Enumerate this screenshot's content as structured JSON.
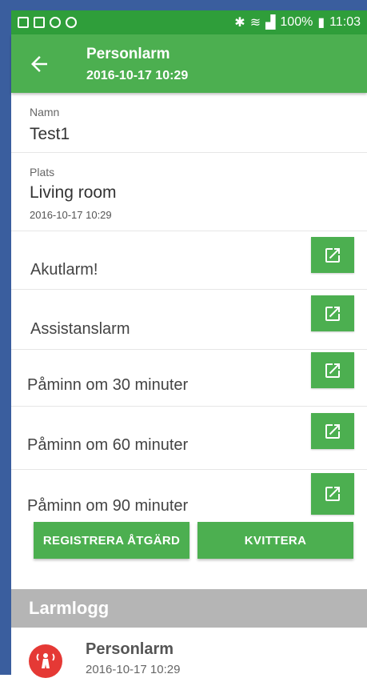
{
  "status_bar": {
    "battery": "100%",
    "time": "11:03"
  },
  "app_bar": {
    "title": "Personlarm",
    "subtitle": "2016-10-17 10:29"
  },
  "details": {
    "name_label": "Namn",
    "name_value": "Test1",
    "place_label": "Plats",
    "place_value": "Living room",
    "place_time": "2016-10-17 10:29"
  },
  "actions": [
    {
      "label": "Akutlarm!"
    },
    {
      "label": "Assistanslarm"
    },
    {
      "label": "Påminn om 30 minuter"
    },
    {
      "label": "Påminn om 60 minuter"
    },
    {
      "label": "Påminn om 90 minuter"
    }
  ],
  "buttons": {
    "register": "REGISTRERA ÅTGÄRD",
    "acknowledge": "KVITTERA"
  },
  "log": {
    "header": "Larmlogg",
    "items": [
      {
        "title": "Personlarm",
        "time": "2016-10-17 10:29"
      }
    ]
  }
}
